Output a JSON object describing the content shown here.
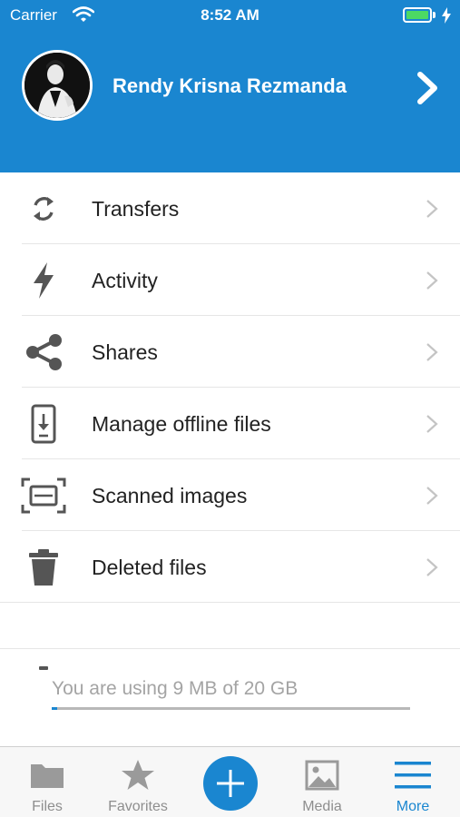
{
  "status_bar": {
    "carrier": "Carrier",
    "time": "8:52 AM"
  },
  "profile": {
    "name": "Rendy Krisna Rezmanda"
  },
  "menu": {
    "items": [
      {
        "label": "Transfers",
        "icon": "sync-icon"
      },
      {
        "label": "Activity",
        "icon": "lightning-icon"
      },
      {
        "label": "Shares",
        "icon": "share-icon"
      },
      {
        "label": "Manage offline files",
        "icon": "phone-download-icon"
      },
      {
        "label": "Scanned images",
        "icon": "scan-icon"
      },
      {
        "label": "Deleted files",
        "icon": "trash-icon"
      }
    ]
  },
  "storage": {
    "text": "You are using 9 MB of 20 GB",
    "used_fraction": 0.0004
  },
  "tabs": [
    {
      "label": "Files",
      "icon": "folder-icon",
      "active": false
    },
    {
      "label": "Favorites",
      "icon": "star-icon",
      "active": false
    },
    {
      "label": "",
      "icon": "plus-icon",
      "active": false
    },
    {
      "label": "Media",
      "icon": "image-icon",
      "active": false
    },
    {
      "label": "More",
      "icon": "menu-icon",
      "active": true
    }
  ],
  "colors": {
    "brand": "#1a86d0",
    "battery": "#4cd964",
    "inactive": "#8e8e8e"
  }
}
